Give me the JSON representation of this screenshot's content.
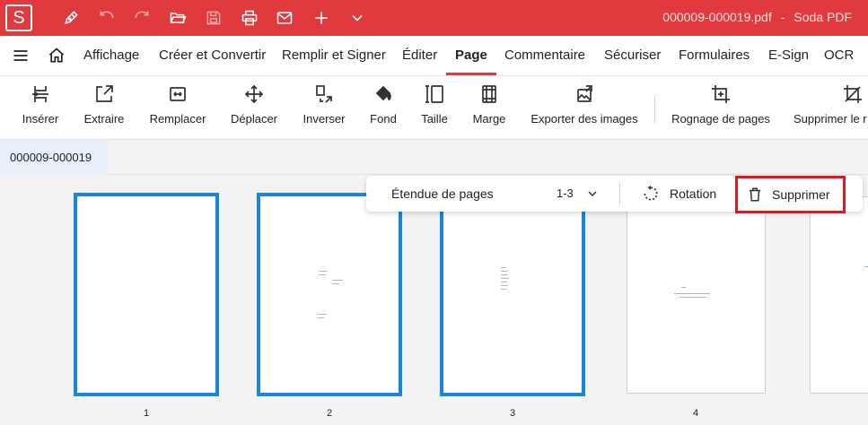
{
  "app": {
    "logo_letter": "S",
    "filename": "000009-000019.pdf",
    "app_name": "Soda PDF",
    "accent_color": "#e03a3e"
  },
  "quick_access": [
    {
      "name": "pen-icon"
    },
    {
      "name": "undo-icon"
    },
    {
      "name": "redo-icon"
    },
    {
      "name": "open-folder-icon"
    },
    {
      "name": "save-icon"
    },
    {
      "name": "print-icon"
    },
    {
      "name": "mail-icon"
    },
    {
      "name": "plus-icon"
    },
    {
      "name": "chevron-down-icon"
    }
  ],
  "menu": {
    "items": [
      "Affichage",
      "Créer et Convertir",
      "Remplir et Signer",
      "Éditer",
      "Page",
      "Commentaire",
      "Sécuriser",
      "Formulaires",
      "E-Sign",
      "OCR"
    ],
    "active": "Page"
  },
  "ribbon": {
    "tools": [
      "Insérer",
      "Extraire",
      "Remplacer",
      "Déplacer",
      "Inverser",
      "Fond",
      "Taille",
      "Marge",
      "Exporter des images",
      "Rognage de pages",
      "Supprimer le r"
    ]
  },
  "doc_tab": "000009-000019",
  "page_toolbar": {
    "range_label": "Étendue de pages",
    "range_value": "1-3",
    "rotate_label": "Rotation",
    "delete_label": "Supprimer",
    "highlight_color": "#e8141c"
  },
  "pages": [
    {
      "number": "1",
      "selected": true
    },
    {
      "number": "2",
      "selected": true
    },
    {
      "number": "3",
      "selected": true
    },
    {
      "number": "4",
      "selected": false
    }
  ],
  "selection_color": "#1a86d8"
}
